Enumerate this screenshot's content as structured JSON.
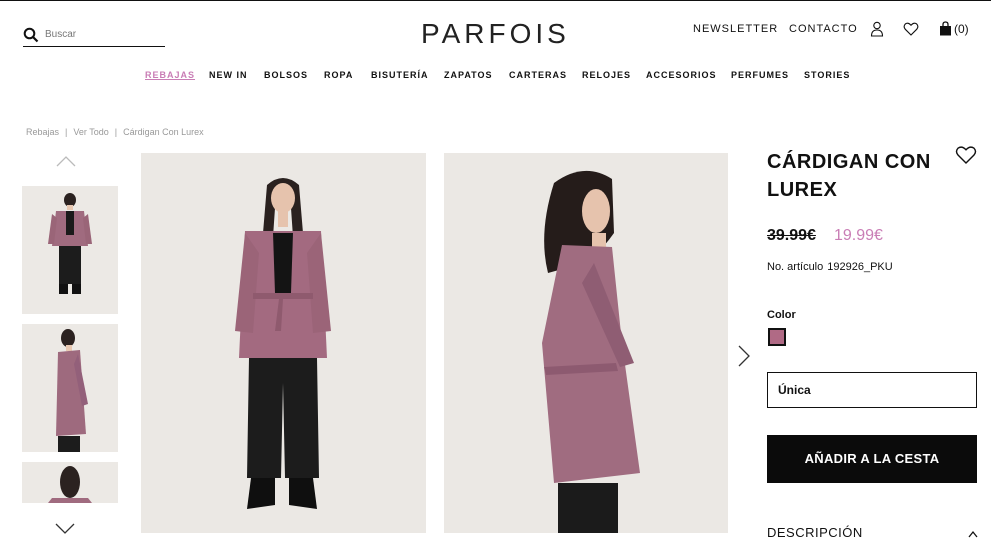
{
  "header": {
    "search_placeholder": "Buscar",
    "logo": "PARFOIS",
    "newsletter": "NEWSLETTER",
    "contact": "CONTACTO",
    "cart_count": "(0)"
  },
  "nav": {
    "items": [
      "REBAJAS",
      "NEW IN",
      "BOLSOS",
      "ROPA",
      "BISUTERÍA",
      "ZAPATOS",
      "CARTERAS",
      "RELOJES",
      "ACCESORIOS",
      "PERFUMES",
      "STORIES"
    ]
  },
  "breadcrumb": {
    "items": [
      "Rebajas",
      "Ver Todo",
      "Cárdigan Con Lurex"
    ],
    "separator": "|"
  },
  "product": {
    "title": "CÁRDIGAN CON LUREX",
    "price_old": "39.99€",
    "price_new": "19.99€",
    "sku_label": "No. artículo",
    "sku": "192926_PKU",
    "color_label": "Color",
    "size": "Única",
    "add_to_cart": "AÑADIR A LA CESTA",
    "description": "DESCRIPCIÓN"
  },
  "colors": {
    "accent_pink": "#c97db5",
    "swatch": "#b06a85",
    "button_bg": "#0b0b0b"
  },
  "icons": [
    "search-icon",
    "user-icon",
    "heart-icon",
    "bag-icon",
    "chevron-up-icon",
    "chevron-down-icon",
    "chevron-right-icon"
  ]
}
